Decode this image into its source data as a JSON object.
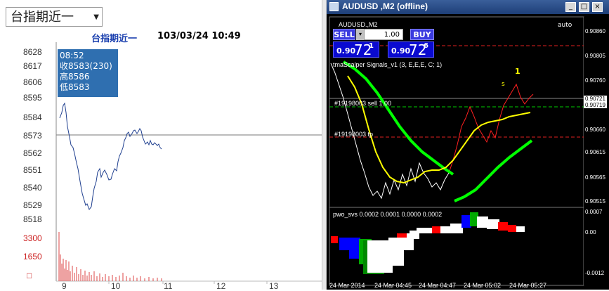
{
  "left": {
    "select_value": "台指期近一",
    "chart_title": "台指期近一",
    "chart_datetime": "103/03/24 10:49",
    "y_ticks": [
      "8628",
      "8617",
      "8606",
      "8595",
      "8584",
      "8573",
      "8562",
      "8551",
      "8540",
      "8529",
      "8518"
    ],
    "vol_ticks": [
      "3300",
      "1650"
    ],
    "vol_zero": "□",
    "x_ticks": [
      "9",
      "10",
      "11",
      "12",
      "13"
    ],
    "tooltip": {
      "time": "08:52",
      "close": "收8583(230)",
      "high": "高8586",
      "low": "低8583"
    },
    "colors": {
      "price_line": "#1f3f8f",
      "volume": "#d44",
      "ref_line": "#bbbbbb",
      "tooltip_bg": "#2f6fb0"
    },
    "chart_data": {
      "type": "line",
      "ylim": [
        8518,
        8628
      ],
      "reference_level": 8573,
      "price_series": [
        [
          "08:45",
          8583
        ],
        [
          "08:52",
          8583
        ],
        [
          "08:55",
          8592
        ],
        [
          "09:00",
          8578
        ],
        [
          "09:05",
          8555
        ],
        [
          "09:10",
          8545
        ],
        [
          "09:15",
          8534
        ],
        [
          "09:20",
          8528
        ],
        [
          "09:25",
          8530
        ],
        [
          "09:30",
          8542
        ],
        [
          "09:35",
          8546
        ],
        [
          "09:40",
          8548
        ],
        [
          "09:45",
          8551
        ],
        [
          "09:50",
          8550
        ],
        [
          "09:55",
          8556
        ],
        [
          "10:00",
          8560
        ],
        [
          "10:05",
          8566
        ],
        [
          "10:10",
          8570
        ],
        [
          "10:15",
          8574
        ],
        [
          "10:20",
          8572
        ],
        [
          "10:25",
          8568
        ],
        [
          "10:30",
          8570
        ],
        [
          "10:35",
          8567
        ],
        [
          "10:40",
          8568
        ],
        [
          "10:45",
          8566
        ],
        [
          "10:49",
          8566
        ]
      ]
    }
  },
  "mt4": {
    "window_title": "AUDUSD ,M2 (offline)",
    "symbol_label": "AUDUSD.,M2",
    "auto_label": "auto",
    "sell_label": "SELL",
    "buy_label": "BUY",
    "lot_value": "1.00",
    "sell_quote": {
      "prefix": "0.90",
      "main": "72",
      "sup": "1"
    },
    "buy_quote": {
      "prefix": "0.90",
      "main": "72",
      "sup": "6"
    },
    "indicator_label": "tmaScalper Signals_v1 (3, E,E,E, C; 1)",
    "order_sell_label": "#19198003 sell 1.00",
    "order_tp_label": "#19198003 tp",
    "signal_s": "s",
    "signal_1": "1",
    "y_ticks": [
      "0.90860",
      "0.90805",
      "0.90760",
      "0.90710",
      "0.90660",
      "0.90615",
      "0.90565",
      "0.90515"
    ],
    "price_box_a": "0.90721",
    "price_box_b": "0.90719",
    "sub_indicator_label": "pwo_svs 0.0002 0.0001 0.0000 0.0002",
    "sub_y_ticks": [
      "0.0007",
      "0.00",
      "-0.0012"
    ],
    "x_ticks": [
      "24 Mar 2014",
      "24 Mar 04:45",
      "24 Mar 04:47",
      "24 Mar 05:02",
      "24 Mar 05:27"
    ],
    "win_buttons": [
      "_",
      "□",
      "×"
    ],
    "colors": {
      "bg": "#000000",
      "bull": "#ff2020",
      "bear": "#ffffff",
      "ma_yellow": "#ffff00",
      "band_green": "#00ff00",
      "sell_line": "#ff3030",
      "tp_line": "#ff3030",
      "bid_line": "#00cc00"
    }
  }
}
